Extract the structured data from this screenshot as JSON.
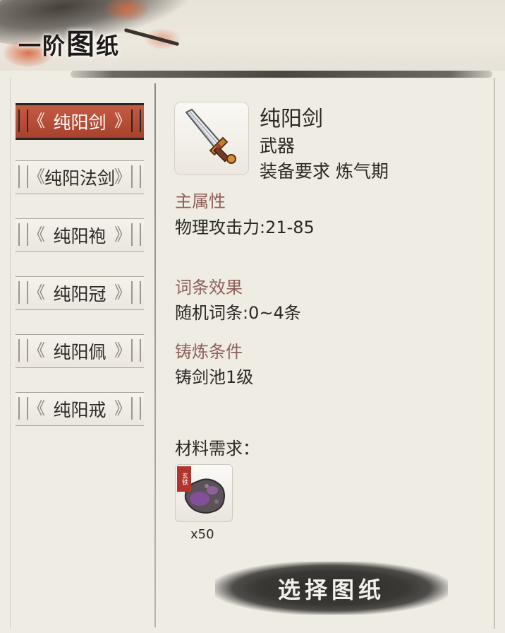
{
  "header": {
    "title_prefix": "一阶",
    "title_big": "图",
    "title_suffix": "纸"
  },
  "tabs": [
    {
      "label": "纯阳剑",
      "active": true
    },
    {
      "label": "纯阳法剑",
      "active": false
    },
    {
      "label": "纯阳袍",
      "active": false
    },
    {
      "label": "纯阳冠",
      "active": false
    },
    {
      "label": "纯阳佩",
      "active": false
    },
    {
      "label": "纯阳戒",
      "active": false
    }
  ],
  "item": {
    "name": "纯阳剑",
    "type": "武器",
    "requirement": "装备要求 炼气期",
    "icon": "sword-icon"
  },
  "sections": {
    "main_attr_label": "主属性",
    "main_attr_value": "物理攻击力:21-85",
    "affix_label": "词条效果",
    "affix_value": "随机词条:0~4条",
    "forge_label": "铸炼条件",
    "forge_value": "铸剑池1级"
  },
  "materials": {
    "label": "材料需求：",
    "items": [
      {
        "icon": "ore-icon",
        "badge": "玄铁",
        "count": "x50"
      }
    ]
  },
  "buttons": {
    "select": "选择图纸"
  },
  "colors": {
    "accent_red": "#b84e37",
    "label_color": "#8d6058",
    "bg": "#efece4"
  }
}
